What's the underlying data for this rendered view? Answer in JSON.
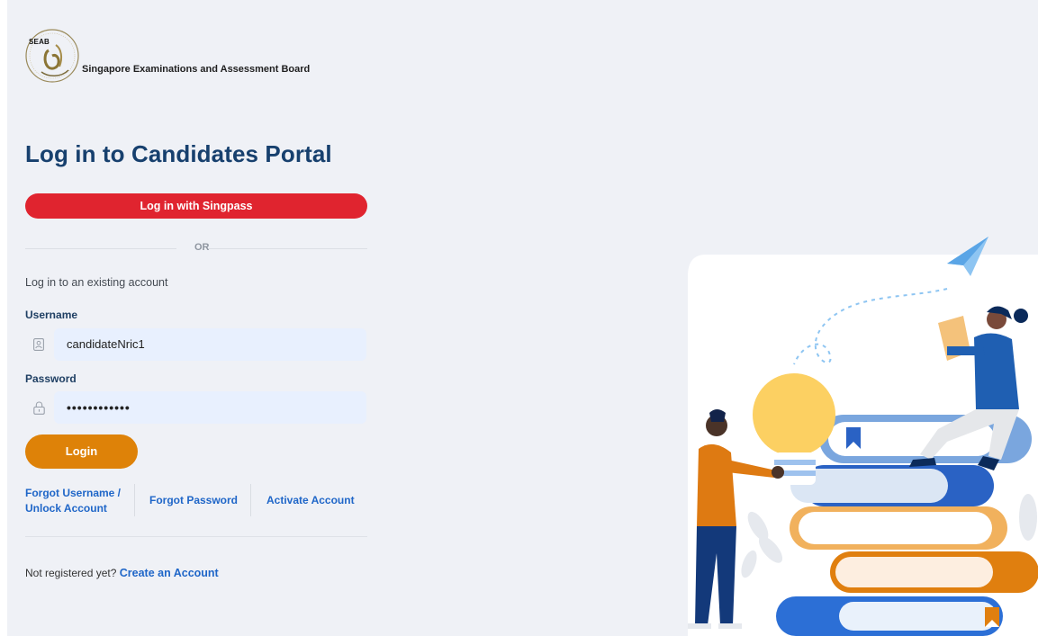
{
  "header": {
    "logo_acronym": "SEAB",
    "org_name": "Singapore Examinations and Assessment Board"
  },
  "login": {
    "title": "Log in to Candidates Portal",
    "singpass_label": "Log in with Singpass",
    "or_text": "OR",
    "existing_text": "Log in to an existing account",
    "username_label": "Username",
    "username_value": "candidateNric1",
    "password_label": "Password",
    "password_value": "••••••••••••",
    "login_label": "Login"
  },
  "links": {
    "forgot_username_line1": "Forgot Username /",
    "forgot_username_line2": "Unlock Account",
    "forgot_password": "Forgot Password",
    "activate_account": "Activate Account"
  },
  "register": {
    "prompt": "Not registered yet?",
    "create": "Create an Account"
  },
  "colors": {
    "brand_navy": "#17406e",
    "singpass_red": "#e0242f",
    "login_orange": "#de8208",
    "link_blue": "#1f66c8",
    "input_bg": "#e8f0fe"
  },
  "icons": {
    "username": "id-card-icon",
    "password": "lock-icon"
  }
}
